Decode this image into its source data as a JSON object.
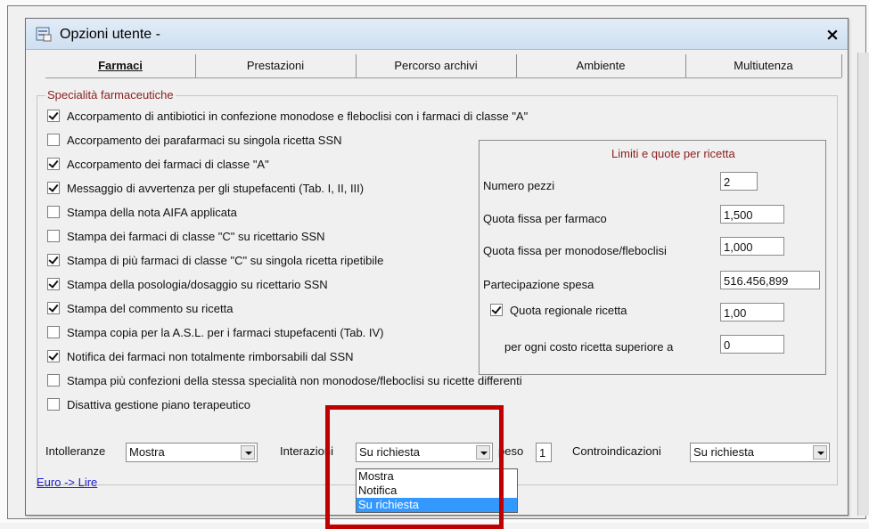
{
  "window": {
    "title": "Opzioni utente -",
    "close_glyph": "×"
  },
  "tabs": [
    {
      "label": "Farmaci",
      "active": true
    },
    {
      "label": "Prestazioni",
      "active": false
    },
    {
      "label": "Percorso archivi",
      "active": false
    },
    {
      "label": "Ambiente",
      "active": false
    },
    {
      "label": "Multiutenza",
      "active": false
    }
  ],
  "specialita": {
    "title": "Specialità farmaceutiche",
    "options": [
      {
        "label": "Accorpamento di antibiotici in confezione monodose e fleboclisi con i farmaci di classe \"A\"",
        "checked": true
      },
      {
        "label": "Accorpamento dei parafarmaci su singola ricetta SSN",
        "checked": false
      },
      {
        "label": "Accorpamento dei farmaci di classe \"A\"",
        "checked": true
      },
      {
        "label": "Messaggio di avvertenza per gli stupefacenti (Tab. I, II, III)",
        "checked": true
      },
      {
        "label": "Stampa della nota AIFA applicata",
        "checked": false
      },
      {
        "label": "Stampa dei farmaci di classe \"C\" su ricettario SSN",
        "checked": false
      },
      {
        "label": "Stampa di più farmaci di classe \"C\" su singola ricetta ripetibile",
        "checked": true
      },
      {
        "label": "Stampa della posologia/dosaggio su ricettario SSN",
        "checked": true
      },
      {
        "label": "Stampa del commento su ricetta",
        "checked": true
      },
      {
        "label": "Stampa copia per la A.S.L. per i farmaci stupefacenti (Tab. IV)",
        "checked": false
      },
      {
        "label": "Notifica dei farmaci non totalmente rimborsabili dal SSN",
        "checked": true
      },
      {
        "label": "Stampa più confezioni della stessa specialità non monodose/fleboclisi su ricette differenti",
        "checked": false
      },
      {
        "label": "Disattiva gestione piano terapeutico",
        "checked": false
      }
    ]
  },
  "limiti": {
    "title": "Limiti e quote per ricetta",
    "numero_pezzi_label": "Numero pezzi",
    "numero_pezzi_value": "2",
    "quota_fissa_farmaco_label": "Quota fissa per farmaco",
    "quota_fissa_farmaco_value": "1,500",
    "quota_fissa_monodose_label": "Quota fissa per monodose/fleboclisi",
    "quota_fissa_monodose_value": "1,000",
    "partecipazione_label": "Partecipazione spesa",
    "partecipazione_value": "516.456,899",
    "quota_regionale_label": "Quota regionale ricetta",
    "quota_regionale_checked": true,
    "quota_regionale_value": "1,00",
    "costo_superiore_label": "per ogni costo ricetta superiore a",
    "costo_superiore_value": "0"
  },
  "bottom": {
    "intolleranze_label": "Intolleranze",
    "intolleranze_value": "Mostra",
    "interazioni_label": "Interazioni",
    "interazioni_value": "Su richiesta",
    "peso_label": "peso",
    "peso_value": "1",
    "controindicazioni_label": "Controindicazioni",
    "controindicazioni_value": "Su richiesta"
  },
  "dropdown_options": [
    "Mostra",
    "Notifica",
    "Su richiesta"
  ],
  "link_label": "Euro -> Lire",
  "colors": {
    "accent_red": "#c00000",
    "group_title": "#8b1f1f",
    "selection": "#3399ff"
  }
}
